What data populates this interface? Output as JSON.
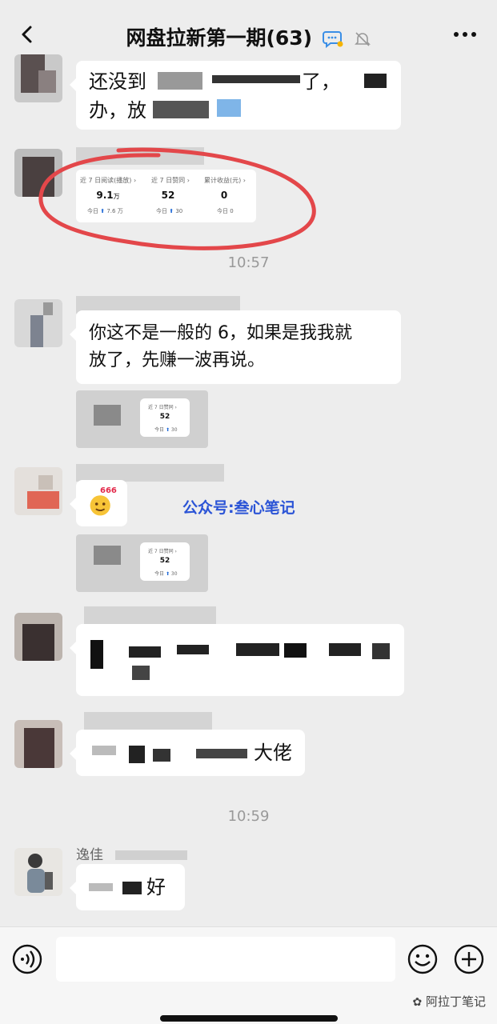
{
  "header": {
    "title": "网盘拉新第一期(63)"
  },
  "messages": [
    {
      "text_line1": "还没到",
      "text_line1_end": "了，",
      "text_line2": "办，放"
    },
    {
      "card": {
        "labels": [
          "近 7 日阅读(播放) ›",
          "近 7 日赞同 ›",
          "累计收益(元) ›"
        ],
        "values": [
          "9.1",
          "52",
          "0"
        ],
        "value_unit": "万",
        "subs": [
          "今日",
          "今日",
          "今日"
        ],
        "sub_values": [
          "7.6 万",
          "30",
          "0"
        ]
      }
    },
    {
      "text_line1": "你这不是一般的 6，如果是我我就",
      "text_line2": "放了，先赚一波再说。"
    },
    {
      "thumb": {
        "label": "近 7 日赞同 ›",
        "value": "52",
        "sub": "今日",
        "sub_value": "30"
      }
    },
    {
      "sticker": "666"
    },
    {
      "thumb": {
        "label": "近 7 日赞同 ›",
        "value": "52",
        "sub": "今日",
        "sub_value": "30"
      }
    },
    {
      "text_end": "大佬"
    },
    {
      "sender": "逸佳",
      "text_end": "好"
    }
  ],
  "times": [
    "10:57",
    "10:59"
  ],
  "watermark_center": "公众号:叁心笔记",
  "watermark_bottom": "阿拉丁笔记",
  "colors": {
    "annotation_circle": "#e3474a",
    "accent_blue": "#2b54d6",
    "bubble": "#ffffff",
    "background": "#ededed"
  }
}
